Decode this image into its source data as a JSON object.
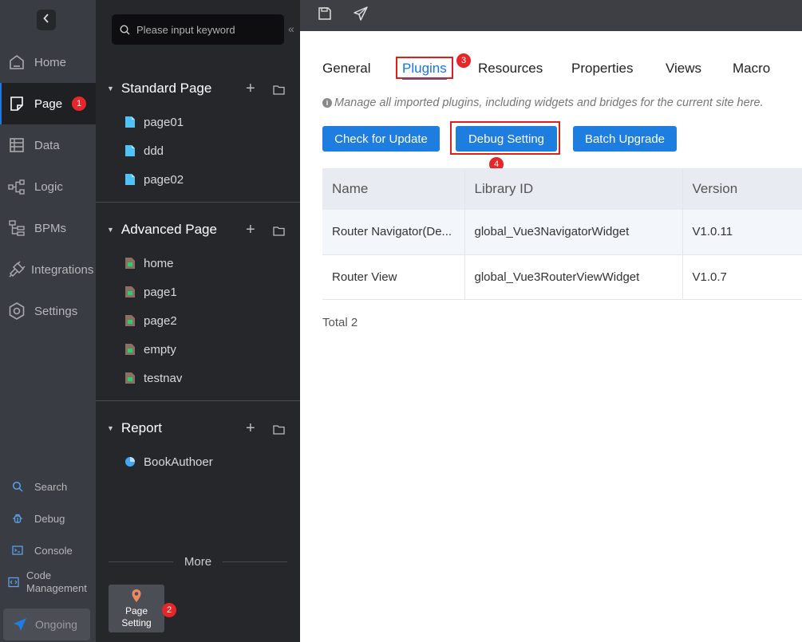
{
  "nav": {
    "items": [
      {
        "label": "Home",
        "icon": "home-icon"
      },
      {
        "label": "Page",
        "icon": "page-icon",
        "badge": "1"
      },
      {
        "label": "Data",
        "icon": "table-icon"
      },
      {
        "label": "Logic",
        "icon": "flow-icon"
      },
      {
        "label": "BPMs",
        "icon": "bpm-icon"
      },
      {
        "label": "Integrations",
        "icon": "plug-icon"
      },
      {
        "label": "Settings",
        "icon": "gear-icon"
      }
    ],
    "tools": [
      {
        "label": "Search"
      },
      {
        "label": "Debug"
      },
      {
        "label": "Console"
      },
      {
        "label": "Code Management"
      }
    ],
    "ongoing": "Ongoing"
  },
  "panel": {
    "search_placeholder": "Please input keyword",
    "sections": [
      {
        "title": "Standard Page",
        "pages": [
          "page01",
          "ddd",
          "page02"
        ]
      },
      {
        "title": "Advanced Page",
        "pages": [
          "home",
          "page1",
          "page2",
          "empty",
          "testnav"
        ]
      },
      {
        "title": "Report",
        "pages": [
          "BookAuthoer"
        ]
      }
    ],
    "more_label": "More",
    "page_setting_line1": "Page",
    "page_setting_line2": "Setting",
    "page_setting_badge": "2"
  },
  "main": {
    "tabs": [
      "General",
      "Plugins",
      "Resources",
      "Properties",
      "Views",
      "Macro"
    ],
    "active_tab": "Plugins",
    "tab_badge": "3",
    "hint": "Manage all imported plugins, including widgets and bridges for the current site here.",
    "buttons": {
      "check": "Check for Update",
      "debug": "Debug Setting",
      "batch": "Batch Upgrade"
    },
    "debug_badge": "4",
    "table": {
      "headers": [
        "Name",
        "Library ID",
        "Version"
      ],
      "rows": [
        [
          "Router Navigator(De...",
          "global_Vue3NavigatorWidget",
          "V1.0.11"
        ],
        [
          "Router View",
          "global_Vue3RouterViewWidget",
          "V1.0.7"
        ]
      ]
    },
    "total": "Total 2"
  },
  "colors": {
    "accent": "#1e7ee0",
    "annotation": "#e01e1e"
  }
}
